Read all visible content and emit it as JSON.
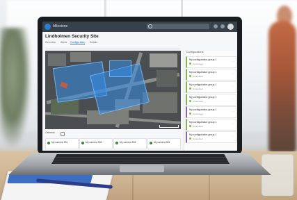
{
  "app": {
    "brand": "Milestone"
  },
  "page": {
    "title": "Lindholmen Security Site"
  },
  "tabs": [
    {
      "label": "Overview"
    },
    {
      "label": "Alerts"
    },
    {
      "label": "Configuration"
    },
    {
      "label": "Details"
    }
  ],
  "right_panel": {
    "heading": "Configurations",
    "items": [
      {
        "title": "My configuration group 1",
        "sub": "Connected",
        "accent": "#7bb84a"
      },
      {
        "title": "My configuration group 1",
        "sub": "Connected",
        "accent": "#7bb84a"
      },
      {
        "title": "My configuration group 1",
        "sub": "Connected",
        "accent": "#7bb84a"
      },
      {
        "title": "My configuration group 1",
        "sub": "Connected",
        "accent": "#7bb84a"
      },
      {
        "title": "My configuration group 1",
        "sub": "Connected",
        "accent": "#8b5cc6"
      },
      {
        "title": "My configuration group 1",
        "sub": "Connected",
        "accent": "#7bb84a"
      },
      {
        "title": "My configuration group 1",
        "sub": "Connected",
        "accent": "#8b5cc6"
      }
    ]
  },
  "cameras": {
    "label": "Cameras",
    "items": [
      {
        "label": "My camera 001"
      },
      {
        "label": "My camera 002"
      },
      {
        "label": "My camera 003"
      },
      {
        "label": "My camera 004"
      }
    ]
  },
  "icons": {
    "logo": "logo-icon",
    "search": "search-icon",
    "notifications": "bell-icon",
    "help": "help-icon",
    "avatar": "user-avatar",
    "more": "more-icon",
    "camera": "camera-icon"
  },
  "colors": {
    "accent": "#2b6fc0",
    "topbar": "#37414b",
    "status_green": "#7bb84a",
    "status_purple": "#8b5cc6",
    "zone_blue": "#348ce6"
  }
}
